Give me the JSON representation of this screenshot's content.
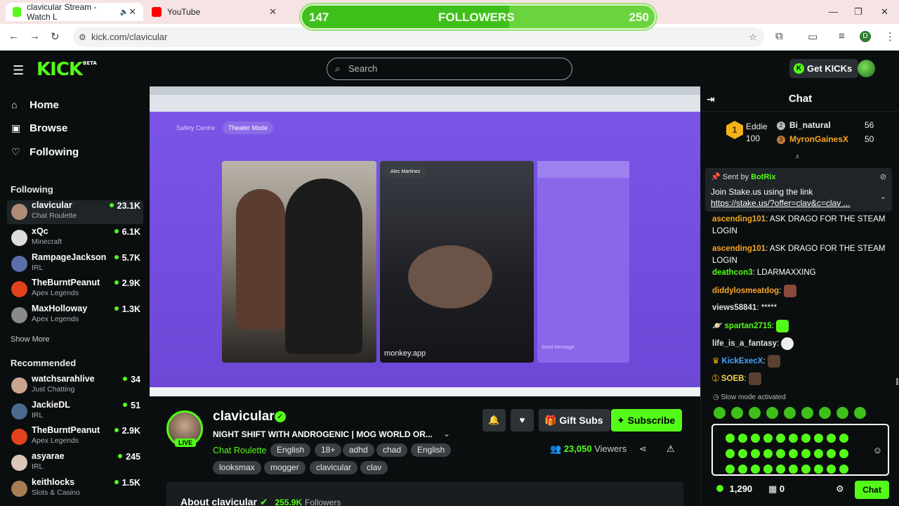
{
  "browser": {
    "tabs": [
      {
        "title": "clavicular Stream - Watch L",
        "active": true
      },
      {
        "title": "YouTube",
        "active": false
      }
    ],
    "url": "kick.com/clavicular",
    "profile_initial": "D"
  },
  "followers_goal": {
    "current": "147",
    "label": "FOLLOWERS",
    "target": "250",
    "progress": 0.588
  },
  "header": {
    "logo": "KICK",
    "logo_badge": "BETA",
    "search_placeholder": "Search",
    "get_kicks": "Get KICKs"
  },
  "sidebar": {
    "nav": [
      {
        "label": "Home",
        "icon": "home-icon"
      },
      {
        "label": "Browse",
        "icon": "browse-icon"
      },
      {
        "label": "Following",
        "icon": "heart-icon"
      }
    ],
    "following_title": "Following",
    "following": [
      {
        "name": "clavicular",
        "category": "Chat Roulette",
        "viewers": "23.1K"
      },
      {
        "name": "xQc",
        "category": "Minecraft",
        "viewers": "6.1K"
      },
      {
        "name": "RampageJackson",
        "category": "IRL",
        "viewers": "5.7K"
      },
      {
        "name": "TheBurntPeanut",
        "category": "Apex Legends",
        "viewers": "2.9K"
      },
      {
        "name": "MaxHolloway",
        "category": "Apex Legends",
        "viewers": "1.3K"
      }
    ],
    "show_more": "Show More",
    "recommended_title": "Recommended",
    "recommended": [
      {
        "name": "watchsarahlive",
        "category": "Just Chatting",
        "viewers": "34"
      },
      {
        "name": "JackieDL",
        "category": "IRL",
        "viewers": "51"
      },
      {
        "name": "TheBurntPeanut",
        "category": "Apex Legends",
        "viewers": "2.9K"
      },
      {
        "name": "asyarae",
        "category": "IRL",
        "viewers": "245"
      },
      {
        "name": "keithlocks",
        "category": "Slots & Casino",
        "viewers": "1.5K"
      }
    ]
  },
  "video": {
    "safety_centre": "Safety Centre",
    "theater_mode": "Theater Mode",
    "cam2_name": "Alec Martinez",
    "cam2_watermark": "monkey.app",
    "send_message": "Send Message"
  },
  "stream": {
    "name": "clavicular",
    "live": "LIVE",
    "title": "NIGHT SHIFT WITH ANDROGENIC | MOG WORLD OR...",
    "category": "Chat Roulette",
    "tags_row1": [
      "English",
      "18+",
      "adhd",
      "chad",
      "English"
    ],
    "tags_row2": [
      "looksmax",
      "mogger",
      "clavicular",
      "clav"
    ],
    "gift_subs": "Gift Subs",
    "subscribe": "Subscribe",
    "viewers": "23,050",
    "viewers_label": "Viewers",
    "about": "About clavicular",
    "followers_count": "255.9K",
    "followers_label": "Followers"
  },
  "chat": {
    "title": "Chat",
    "leaderboard": {
      "first": {
        "rank": "1",
        "name": "Eddie",
        "amount": "100"
      },
      "second": {
        "rank": "2",
        "name": "Bi_natural",
        "amount": "56"
      },
      "third": {
        "rank": "3",
        "name": "MyronGainesX",
        "amount": "50"
      }
    },
    "pinned": {
      "sent_by": "Sent by",
      "bot": "BotRix",
      "message": "Join Stake.us using the link",
      "link": "https://stake.us/?offer=clav&c=clav ..."
    },
    "messages": [
      {
        "user": "ascending101",
        "text": "ASK DRAGO FOR THE STEAM LOGIN",
        "color": "#f5a623"
      },
      {
        "user": "ascending101",
        "text": "ASK DRAGO FOR THE STEAM LOGIN",
        "color": "#f5a623"
      },
      {
        "user": "deathcon3",
        "text": "LDARMAXXING",
        "color": "#53fc18"
      },
      {
        "user": "diddylosmeatdog",
        "text": "",
        "color": "#f5a623"
      },
      {
        "user": "views58841",
        "text": "*****",
        "color": "#e0e0e0"
      },
      {
        "user": "spartan2715",
        "text": "",
        "color": "#53fc18"
      },
      {
        "user": "life_is_a_fantasy",
        "text": "",
        "color": "#e0e0e0"
      },
      {
        "user": "KickExecX",
        "text": "",
        "color": "#4aa3ff"
      },
      {
        "user": "SOEB",
        "text": "",
        "color": "#f5d547"
      }
    ],
    "slow_mode": "Slow mode activated",
    "kicks_balance": "1,290",
    "points": "0",
    "chat_button": "Chat"
  }
}
